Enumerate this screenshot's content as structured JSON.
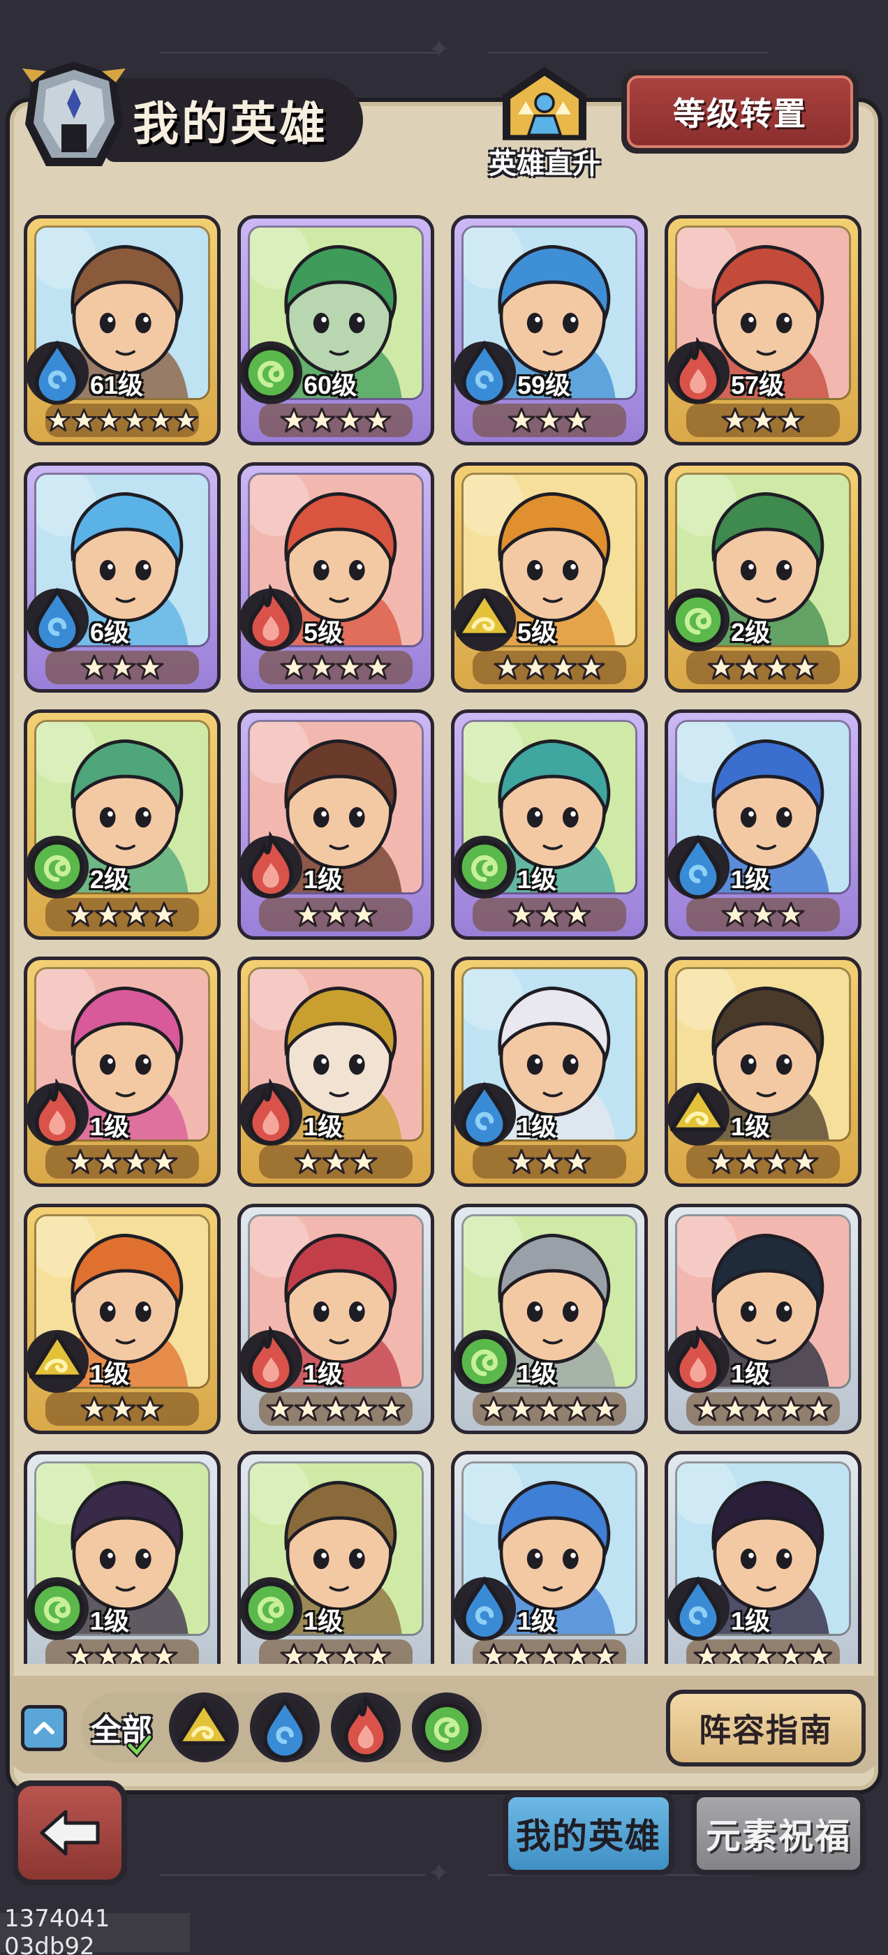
{
  "header": {
    "title": "我的英雄",
    "ascend_label": "英雄直升",
    "level_transfer_button": "等级转置"
  },
  "colors": {
    "water": "#3a8bd6",
    "fire": "#d9534a",
    "wind": "#5bb84a",
    "earth": "#e3c23a",
    "parchment": "#ddd2b8",
    "card_gold": "#e6bc5c",
    "card_purple": "#b29be6",
    "card_silver": "#cdd6df"
  },
  "heroes": [
    {
      "level": "61级",
      "element": "water-icon",
      "stars": 6,
      "rarity": "gold",
      "bg": "#bfe3f2"
    },
    {
      "level": "60级",
      "element": "wind-icon",
      "stars": 4,
      "rarity": "purple",
      "bg": "#cfeaa6"
    },
    {
      "level": "59级",
      "element": "water-icon",
      "stars": 3,
      "rarity": "purple",
      "bg": "#bfe3f2"
    },
    {
      "level": "57级",
      "element": "fire-icon",
      "stars": 3,
      "rarity": "gold",
      "bg": "#f2b8b0"
    },
    {
      "level": "6级",
      "element": "water-icon",
      "stars": 3,
      "rarity": "purple",
      "bg": "#bfe3f2"
    },
    {
      "level": "5级",
      "element": "fire-icon",
      "stars": 4,
      "rarity": "purple",
      "bg": "#f2b8b0"
    },
    {
      "level": "5级",
      "element": "earth-icon",
      "stars": 4,
      "rarity": "gold",
      "bg": "#f6df9a"
    },
    {
      "level": "2级",
      "element": "wind-icon",
      "stars": 4,
      "rarity": "gold",
      "bg": "#cfeaa6"
    },
    {
      "level": "2级",
      "element": "wind-icon",
      "stars": 4,
      "rarity": "gold",
      "bg": "#cfeaa6"
    },
    {
      "level": "1级",
      "element": "fire-icon",
      "stars": 3,
      "rarity": "purple",
      "bg": "#f2b8b0"
    },
    {
      "level": "1级",
      "element": "wind-icon",
      "stars": 3,
      "rarity": "purple",
      "bg": "#cfeaa6"
    },
    {
      "level": "1级",
      "element": "water-icon",
      "stars": 3,
      "rarity": "purple",
      "bg": "#bfe3f2"
    },
    {
      "level": "1级",
      "element": "fire-icon",
      "stars": 4,
      "rarity": "gold",
      "bg": "#f2b8b0"
    },
    {
      "level": "1级",
      "element": "fire-icon",
      "stars": 3,
      "rarity": "gold",
      "bg": "#f2b8b0"
    },
    {
      "level": "1级",
      "element": "water-icon",
      "stars": 3,
      "rarity": "gold",
      "bg": "#bfe3f2"
    },
    {
      "level": "1级",
      "element": "earth-icon",
      "stars": 4,
      "rarity": "gold",
      "bg": "#f6df9a"
    },
    {
      "level": "1级",
      "element": "earth-icon",
      "stars": 3,
      "rarity": "gold",
      "bg": "#f6df9a"
    },
    {
      "level": "1级",
      "element": "fire-icon",
      "stars": 5,
      "rarity": "silver",
      "bg": "#f2b8b0"
    },
    {
      "level": "1级",
      "element": "wind-icon",
      "stars": 5,
      "rarity": "silver",
      "bg": "#cfeaa6"
    },
    {
      "level": "1级",
      "element": "fire-icon",
      "stars": 5,
      "rarity": "silver",
      "bg": "#f2b8b0"
    },
    {
      "level": "1级",
      "element": "wind-icon",
      "stars": 4,
      "rarity": "silver",
      "bg": "#cfeaa6"
    },
    {
      "level": "1级",
      "element": "wind-icon",
      "stars": 4,
      "rarity": "silver",
      "bg": "#cfeaa6"
    },
    {
      "level": "1级",
      "element": "water-icon",
      "stars": 5,
      "rarity": "silver",
      "bg": "#bfe3f2"
    },
    {
      "level": "1级",
      "element": "water-icon",
      "stars": 5,
      "rarity": "silver",
      "bg": "#bfe3f2"
    }
  ],
  "filters": {
    "all_label": "全部",
    "items": [
      "earth-icon",
      "water-icon",
      "fire-icon",
      "wind-icon"
    ],
    "selected": "全部"
  },
  "lineup_guide_button": "阵容指南",
  "tabs": [
    {
      "label": "我的英雄",
      "active": true
    },
    {
      "label": "元素祝福",
      "active": false
    }
  ],
  "watermark": "1374041 03db92"
}
